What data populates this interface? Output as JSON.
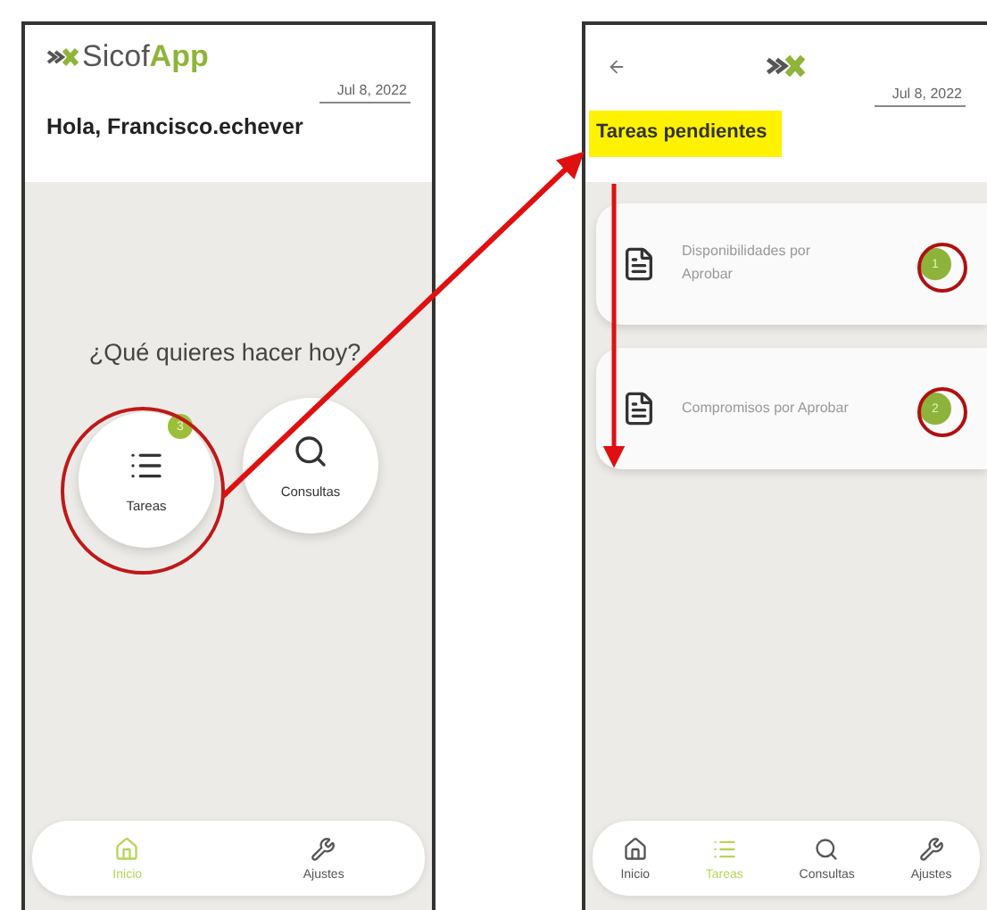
{
  "home_screen": {
    "logo": {
      "brand": "Sicof",
      "product": "App"
    },
    "date": "Jul 8, 2022",
    "greeting": "Hola, Francisco.echever",
    "prompt": "¿Qué quieres hacer hoy?",
    "actions": [
      {
        "kind": "list",
        "label": "Tareas",
        "badge": "3",
        "circled": true
      },
      {
        "kind": "search",
        "label": "Consultas",
        "circled": false
      }
    ],
    "nav": [
      {
        "kind": "home",
        "label": "Inicio",
        "selected": true
      },
      {
        "kind": "wrench",
        "label": "Ajustes",
        "selected": false
      }
    ]
  },
  "tasks_screen": {
    "date": "Jul 8, 2022",
    "title": "Tareas pendientes",
    "title_highlighted": true,
    "tasks": [
      {
        "label": "Disponibilidades por Aprobar",
        "count": "1",
        "circled": true
      },
      {
        "label": "Compromisos por Aprobar",
        "count": "2",
        "circled": true
      }
    ],
    "nav": [
      {
        "kind": "home",
        "label": "Inicio",
        "selected": false
      },
      {
        "kind": "list",
        "label": "Tareas",
        "selected": true
      },
      {
        "kind": "search",
        "label": "Consultas",
        "selected": false
      },
      {
        "kind": "wrench",
        "label": "Ajustes",
        "selected": false
      }
    ]
  }
}
